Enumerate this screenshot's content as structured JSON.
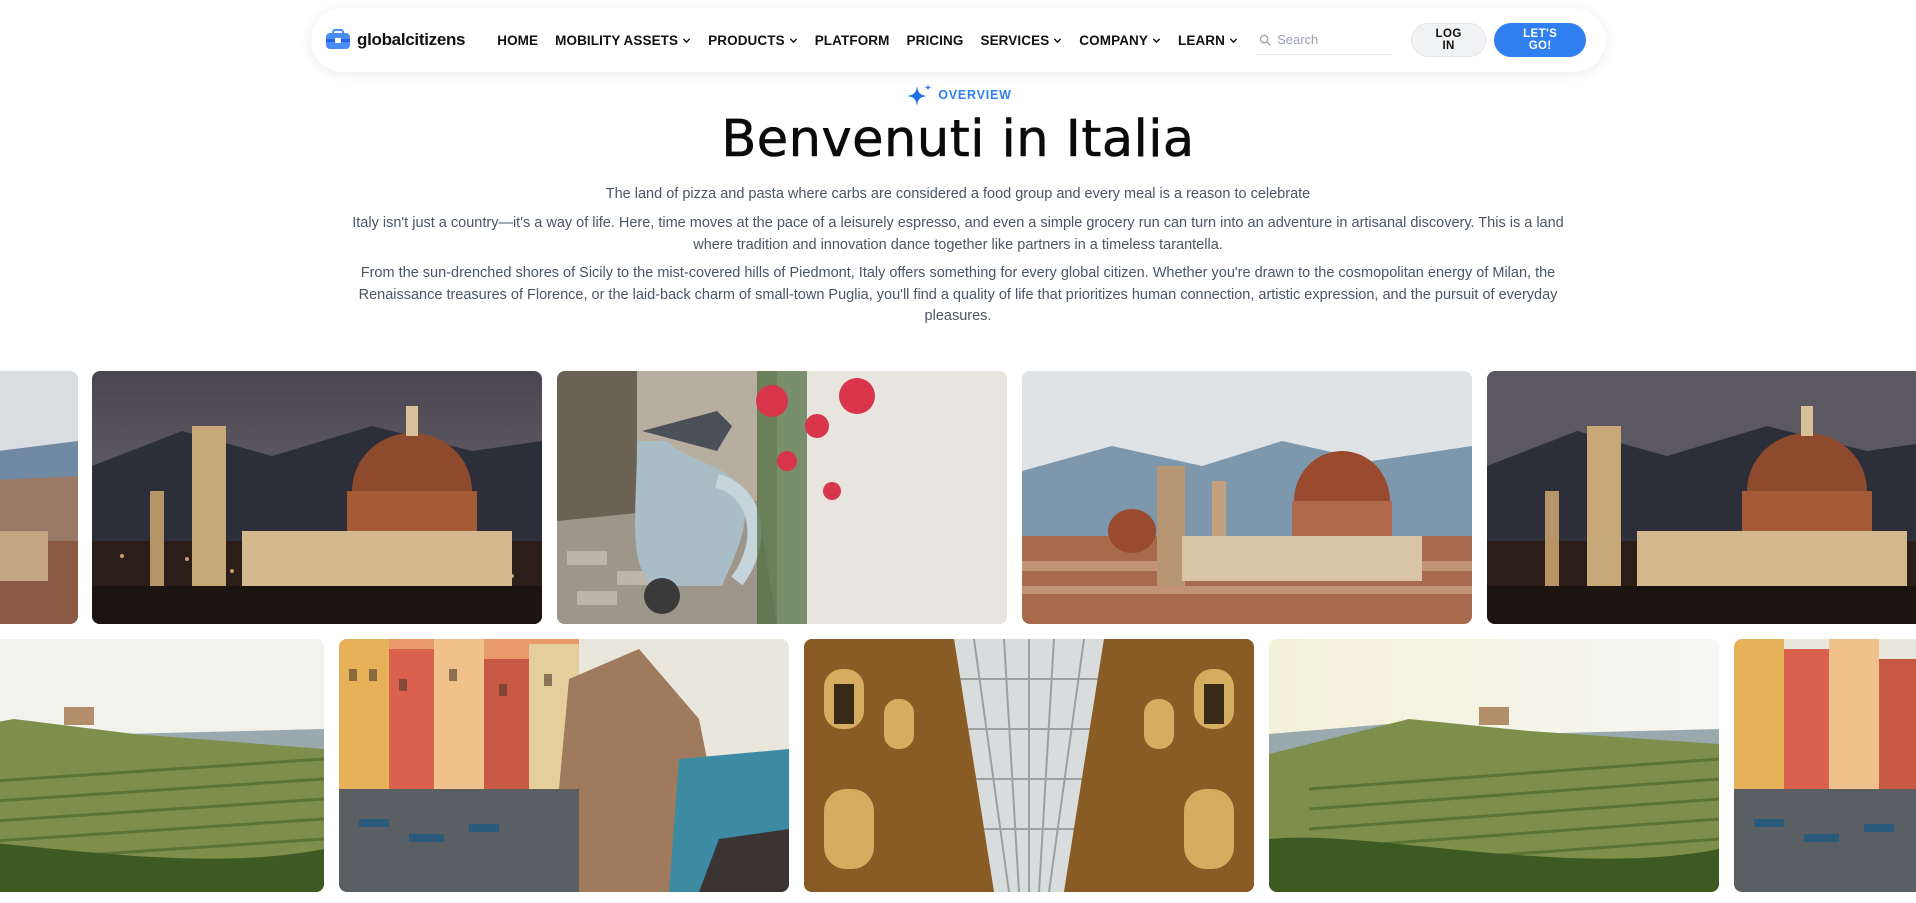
{
  "brand": {
    "name": "globalcitizens",
    "accent": "#2f7ff0"
  },
  "nav": {
    "items": [
      {
        "label": "HOME",
        "dropdown": false
      },
      {
        "label": "MOBILITY ASSETS",
        "dropdown": true
      },
      {
        "label": "PRODUCTS",
        "dropdown": true
      },
      {
        "label": "PLATFORM",
        "dropdown": false
      },
      {
        "label": "PRICING",
        "dropdown": false
      },
      {
        "label": "SERVICES",
        "dropdown": true
      },
      {
        "label": "COMPANY",
        "dropdown": true
      },
      {
        "label": "LEARN",
        "dropdown": true
      }
    ],
    "search_placeholder": "Search",
    "login_label": "LOG IN",
    "cta_label": "LET'S GO!"
  },
  "hero": {
    "eyebrow": "OVERVIEW",
    "title": "Benvenuti in Italia",
    "subtitle": "The land of pizza and pasta where carbs are considered a food group and every meal is a reason to celebrate",
    "paragraph1": "Italy isn't just a country—it's a way of life. Here, time moves at the pace of a leisurely espresso, and even a simple grocery run can turn into an adventure in artisanal discovery. This is a land where tradition and innovation dance together like partners in a timeless tarantella.",
    "paragraph2": "From the sun-drenched shores of Sicily to the mist-covered hills of Piedmont, Italy offers something for every global citizen. Whether you're drawn to the cosmopolitan energy of Milan, the Renaissance treasures of Florence, or the laid-back charm of small-town Puglia, you'll find a quality of life that prioritizes human connection, artistic expression, and the pursuit of everyday pleasures."
  },
  "gallery": {
    "row1": [
      "florence-duomo-day",
      "florence-duomo-night",
      "vespa-scooter",
      "florence-duomo-day",
      "florence-duomo-night"
    ],
    "row2": [
      "tuscan-vineyard",
      "cinque-terre",
      "galleria-milan",
      "tuscan-vineyard",
      "cinque-terre"
    ]
  }
}
